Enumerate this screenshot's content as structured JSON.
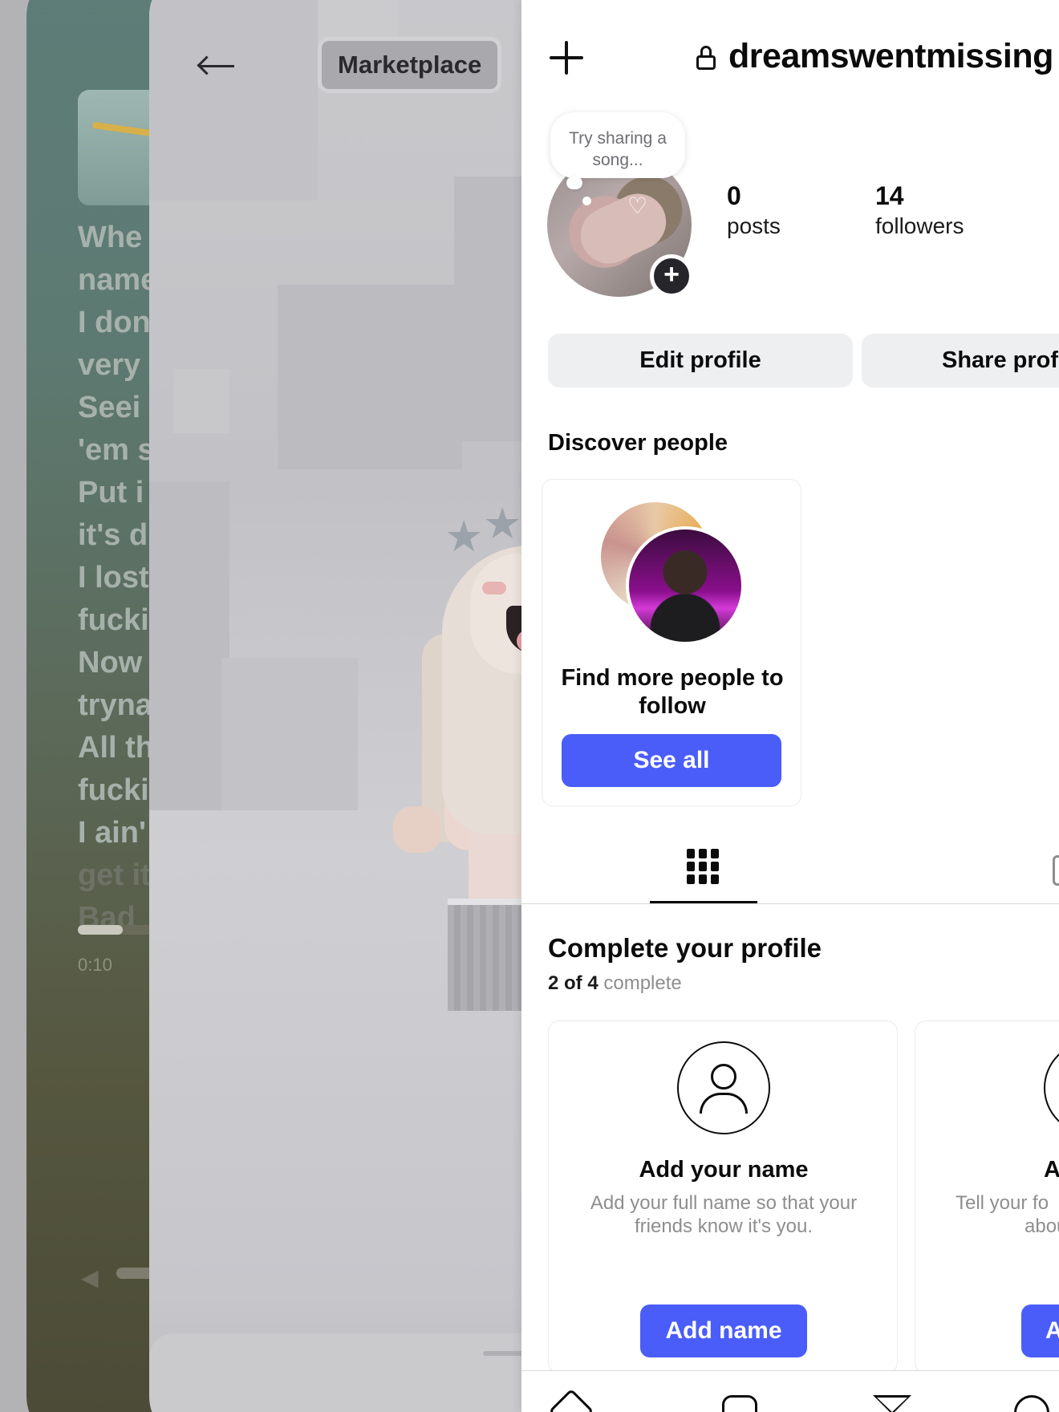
{
  "music_card": {
    "lyrics": [
      "Whe",
      "name",
      "I don",
      "very",
      "Seei",
      "'em s",
      "Put i",
      "it's d",
      "I lost",
      "fucki",
      "Now",
      "tryna",
      "All th",
      "fucki",
      "I ain'",
      "get it",
      "Bad"
    ],
    "elapsed": "0:10",
    "progress_fraction": 0.2
  },
  "roblox_card": {
    "tab_label": "Marketplace",
    "back_icon": "left-arrow-icon"
  },
  "profile": {
    "username": "dreamswentmissing",
    "note_prompt": "Try sharing a song...",
    "stats": [
      {
        "value": "0",
        "label": "posts"
      },
      {
        "value": "14",
        "label": "followers"
      }
    ],
    "edit_profile_label": "Edit profile",
    "share_profile_label": "Share prof",
    "discover": {
      "heading": "Discover people",
      "title": "Find more people to follow",
      "button": "See all"
    },
    "complete": {
      "title": "Complete your profile",
      "done": "2 of 4",
      "suffix": "complete",
      "cards": [
        {
          "heading": "Add your name",
          "body": "Add your full name so that your friends know it's you.",
          "button": "Add name"
        },
        {
          "heading": "Ad",
          "body_line1": "Tell your fo",
          "body_line2": "abou",
          "button": "A"
        }
      ]
    }
  },
  "colors": {
    "accent_blue": "#4a5df9",
    "button_grey": "#eeeff1"
  }
}
